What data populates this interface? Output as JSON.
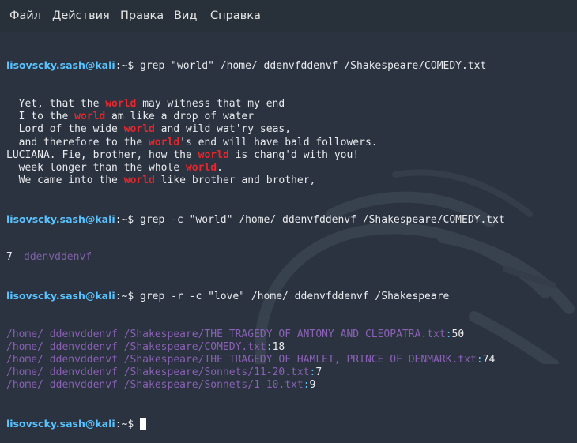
{
  "menu": [
    "Файл",
    "Действия",
    "Правка",
    "Вид",
    "Справка"
  ],
  "colors": {
    "background": "#2b3340",
    "prompt_user": "#5bc3ff",
    "match_highlight": "#e8262d",
    "path": "#8a61b5"
  },
  "prompt": {
    "user": "lisovscky.sash@kali",
    "suffix": ":~$"
  },
  "commands": {
    "cmd1": "grep \"world\" /home/ ddenvfddenvf /Shakespeare/COMEDY.txt",
    "cmd2": "grep -c \"world\" /home/ ddenvfddenvf /Shakespeare/COMEDY.txt",
    "cmd3": "grep -r -c \"love\" /home/ ddenvfddenvf /Shakespeare"
  },
  "grep_output": [
    {
      "pre": "  Yet, that the ",
      "match": "world",
      "post": " may witness that my end"
    },
    {
      "pre": "  I to the ",
      "match": "world",
      "post": " am like a drop of water"
    },
    {
      "pre": "  Lord of the wide ",
      "match": "world",
      "post": " and wild wat'ry seas,"
    },
    {
      "pre": "  and therefore to the ",
      "match": "world",
      "post": "'s end will have bald followers."
    },
    {
      "pre": "LUCIANA. Fie, brother, how the ",
      "match": "world",
      "post": " is chang'd with you!"
    },
    {
      "pre": "  week longer than the whole ",
      "match": "world",
      "post": "."
    },
    {
      "pre": "  We came into the ",
      "match": "world",
      "post": " like brother and brother,"
    }
  ],
  "count_output": "7",
  "recursive_output": [
    {
      "path": "/home/ ddenvddenvf /Shakespeare/THE TRAGEDY OF ANTONY AND CLEOPATRA.txt",
      "count": "50"
    },
    {
      "path": "/home/ ddenvddenvf /Shakespeare/COMEDY.txt",
      "count": "18"
    },
    {
      "path": "/home/ ddenvddenvf /Shakespeare/THE TRAGEDY OF HAMLET, PRINCE OF DENMARK.txt",
      "count": "74"
    },
    {
      "path": "/home/ ddenvddenvf /Shakespeare/Sonnets/11-20.txt",
      "count": "7"
    },
    {
      "path": "/home/ ddenvddenvf /Shakespeare/Sonnets/1-10.txt",
      "count": "9"
    }
  ],
  "ghost_text": "ddenvddenvf"
}
